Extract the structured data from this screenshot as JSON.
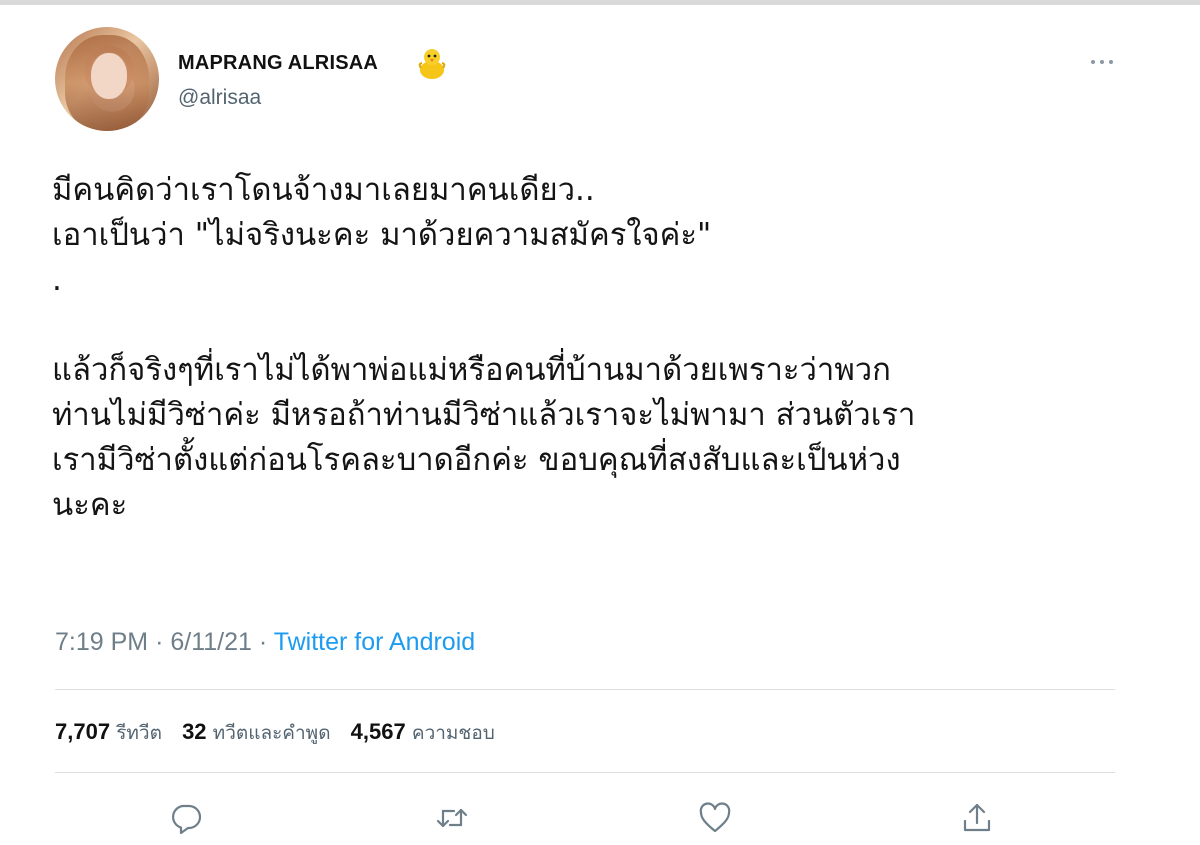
{
  "tweet": {
    "author": {
      "display_name": "MAPRANG ALRISAA",
      "emoji_icon": "chick-icon",
      "handle": "@alrisaa"
    },
    "text": "มีคนคิดว่าเราโดนจ้างมาเลยมาคนเดียว..\n เอาเป็นว่า \"ไม่จริงนะคะ มาด้วยความสมัครใจค่ะ\"\n.\n\nแล้วก็จริงๆที่เราไม่ได้พาพ่อแม่หรือคนที่บ้านมาด้วยเพราะว่าพวก\nท่านไม่มีวิซ่าค่ะ มีหรอถ้าท่านมีวิซ่าแล้วเราจะไม่พามา ส่วนตัวเรา\nเรามีวิซ่าตั้งแต่ก่อนโรคละบาดอีกค่ะ ขอบคุณที่สงสับและเป็นห่วง\nนะคะ",
    "time": "7:19 PM",
    "date": "6/11/21",
    "separator": "·",
    "source": "Twitter for Android",
    "stats": [
      {
        "count": "7,707",
        "label": "รีทวีต"
      },
      {
        "count": "32",
        "label": "ทวีตและคำพูด"
      },
      {
        "count": "4,567",
        "label": "ความชอบ"
      }
    ],
    "actions": [
      "reply-icon",
      "retweet-icon",
      "like-icon",
      "share-icon"
    ]
  },
  "colors": {
    "accent": "#1d9bf0",
    "muted": "#536471",
    "divider": "#dcdfe2"
  }
}
